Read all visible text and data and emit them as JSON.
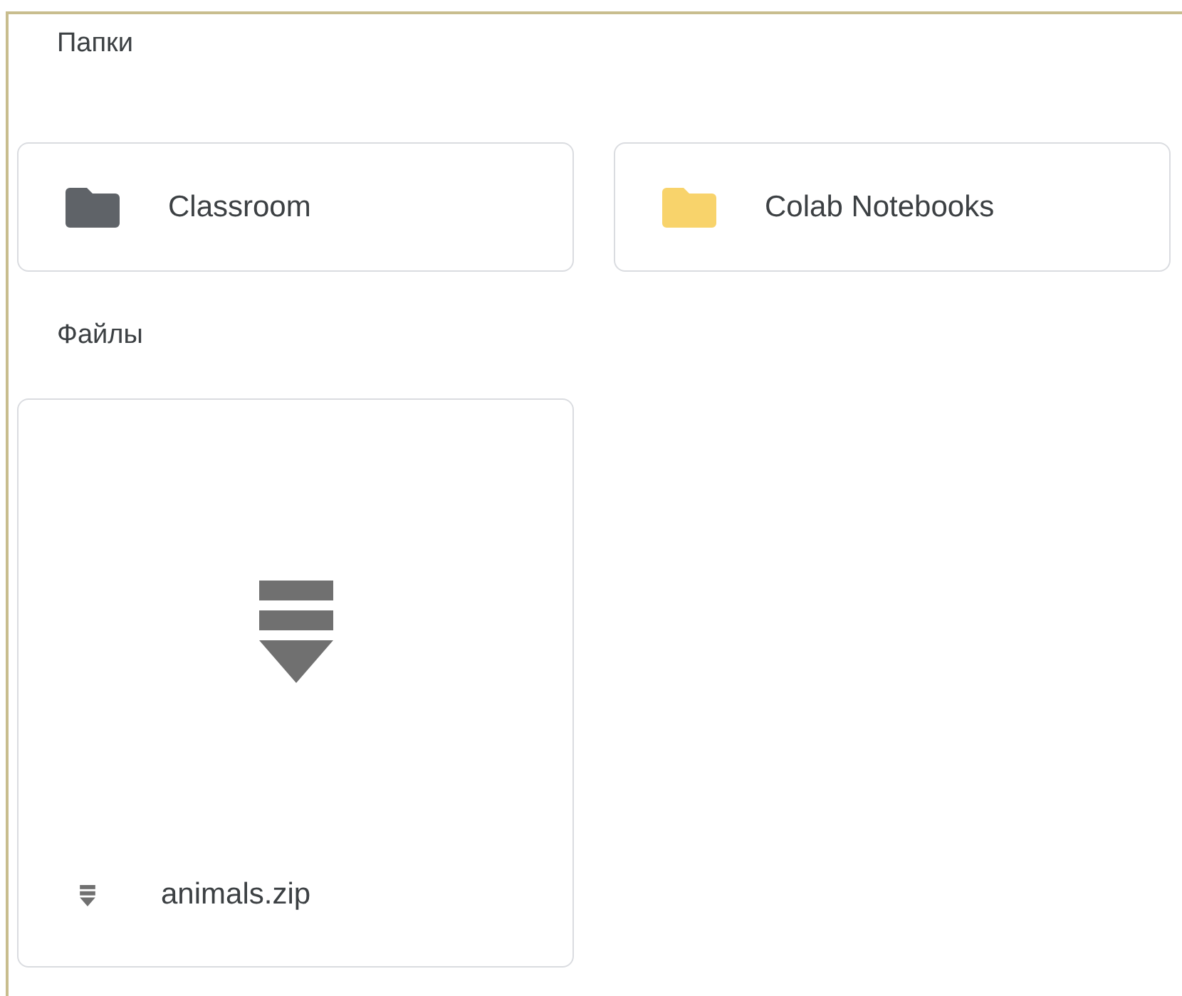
{
  "sections": [
    {
      "kind": "folders",
      "title": "Папки",
      "items": [
        {
          "name": "Classroom",
          "color": "#5f6368"
        },
        {
          "name": "Colab Notebooks",
          "color": "#f8d36b"
        }
      ]
    },
    {
      "kind": "files",
      "title": "Файлы",
      "items": [
        {
          "name": "animals.zip"
        }
      ]
    }
  ]
}
